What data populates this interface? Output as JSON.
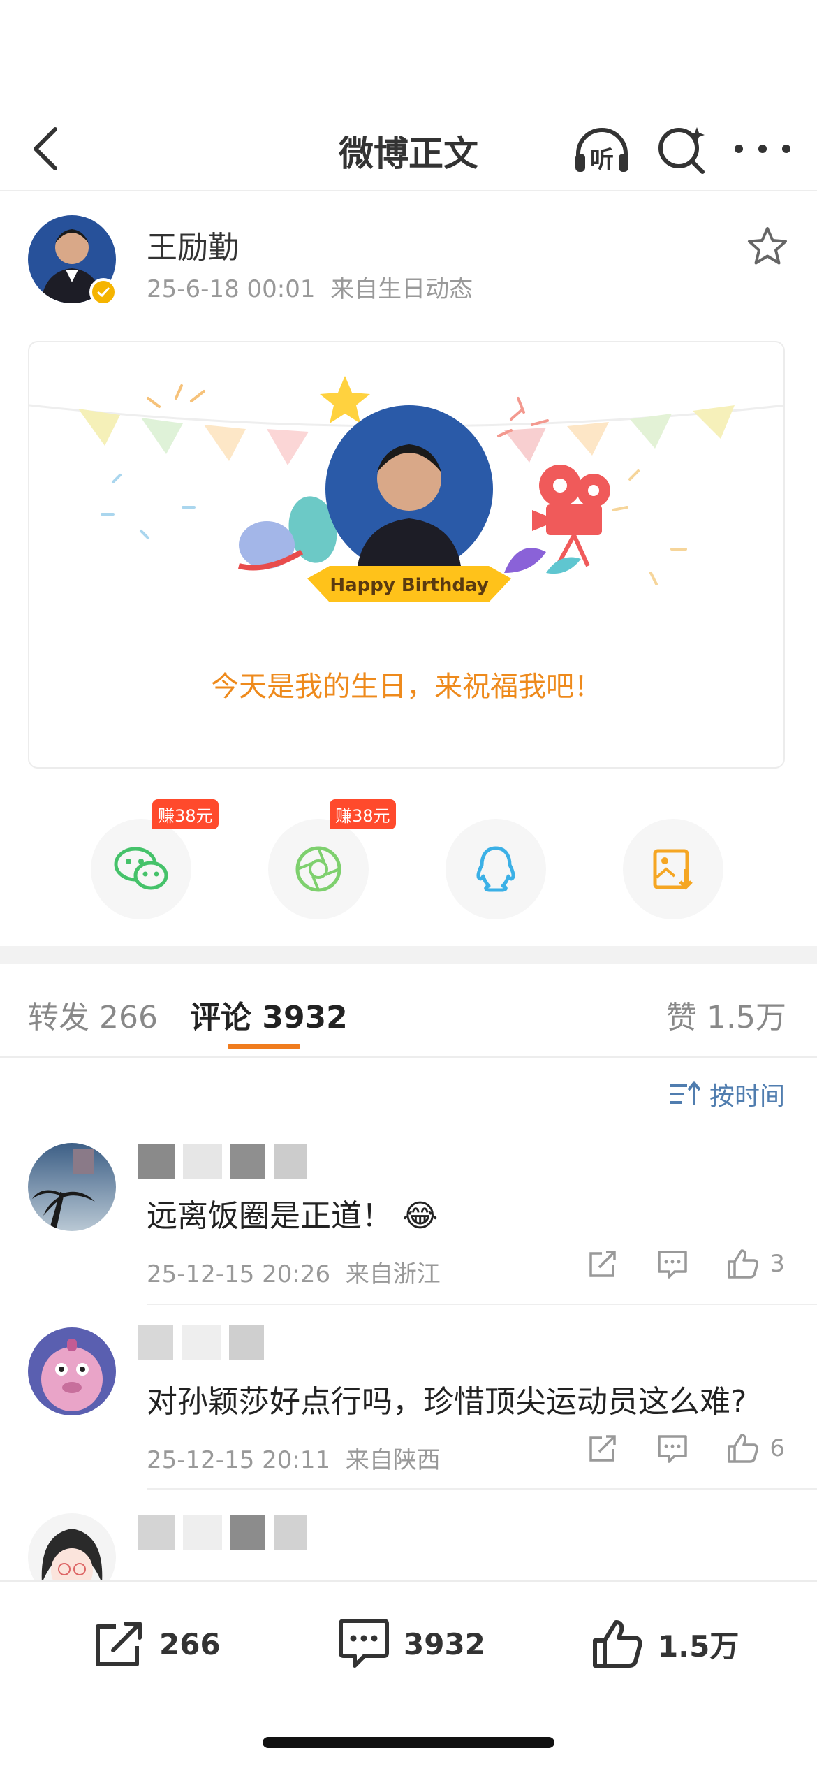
{
  "nav": {
    "title": "微博正文",
    "listen_label": "听"
  },
  "author": {
    "name": "王励勤",
    "time": "25-6-18 00:01",
    "source": "来自生日动态"
  },
  "card": {
    "banner_text": "Happy Birthday",
    "message": "今天是我的生日，来祝福我吧！"
  },
  "share": {
    "wechat_tag": "赚38元",
    "moments_tag": "赚38元"
  },
  "tabs": {
    "forward_label": "转发",
    "forward_count": "266",
    "comment_label": "评论",
    "comment_count": "3932",
    "like_label": "赞",
    "like_count": "1.5万"
  },
  "sort": {
    "label": "按时间"
  },
  "comments": [
    {
      "text": "远离饭圈是正道！",
      "emoji": "😂",
      "time": "25-12-15 20:26",
      "location": "来自浙江",
      "likes": "3"
    },
    {
      "text": "对孙颖莎好点行吗，珍惜顶尖运动员这么难?",
      "time": "25-12-15 20:11",
      "location": "来自陕西",
      "likes": "6"
    }
  ],
  "bottom": {
    "forward_count": "266",
    "comment_count": "3932",
    "like_count": "1.5万"
  },
  "colors": {
    "accent_orange": "#f07c1e",
    "link_blue": "#507daf",
    "earn_red": "#ff4a2c",
    "verified_gold": "#f5b400"
  }
}
